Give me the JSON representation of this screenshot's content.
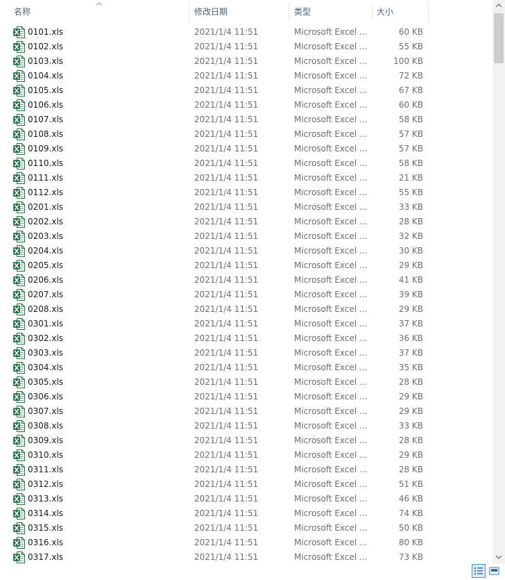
{
  "header": {
    "name_label": "名称",
    "date_label": "修改日期",
    "type_label": "类型",
    "size_label": "大小"
  },
  "accent_color": "#217346",
  "files": [
    {
      "name": "0101.xls",
      "date": "2021/1/4 11:51",
      "type": "Microsoft Excel ...",
      "size": "60 KB"
    },
    {
      "name": "0102.xls",
      "date": "2021/1/4 11:51",
      "type": "Microsoft Excel ...",
      "size": "55 KB"
    },
    {
      "name": "0103.xls",
      "date": "2021/1/4 11:51",
      "type": "Microsoft Excel ...",
      "size": "100 KB"
    },
    {
      "name": "0104.xls",
      "date": "2021/1/4 11:51",
      "type": "Microsoft Excel ...",
      "size": "72 KB"
    },
    {
      "name": "0105.xls",
      "date": "2021/1/4 11:51",
      "type": "Microsoft Excel ...",
      "size": "67 KB"
    },
    {
      "name": "0106.xls",
      "date": "2021/1/4 11:51",
      "type": "Microsoft Excel ...",
      "size": "60 KB"
    },
    {
      "name": "0107.xls",
      "date": "2021/1/4 11:51",
      "type": "Microsoft Excel ...",
      "size": "58 KB"
    },
    {
      "name": "0108.xls",
      "date": "2021/1/4 11:51",
      "type": "Microsoft Excel ...",
      "size": "57 KB"
    },
    {
      "name": "0109.xls",
      "date": "2021/1/4 11:51",
      "type": "Microsoft Excel ...",
      "size": "57 KB"
    },
    {
      "name": "0110.xls",
      "date": "2021/1/4 11:51",
      "type": "Microsoft Excel ...",
      "size": "58 KB"
    },
    {
      "name": "0111.xls",
      "date": "2021/1/4 11:51",
      "type": "Microsoft Excel ...",
      "size": "21 KB"
    },
    {
      "name": "0112.xls",
      "date": "2021/1/4 11:51",
      "type": "Microsoft Excel ...",
      "size": "55 KB"
    },
    {
      "name": "0201.xls",
      "date": "2021/1/4 11:51",
      "type": "Microsoft Excel ...",
      "size": "33 KB"
    },
    {
      "name": "0202.xls",
      "date": "2021/1/4 11:51",
      "type": "Microsoft Excel ...",
      "size": "28 KB"
    },
    {
      "name": "0203.xls",
      "date": "2021/1/4 11:51",
      "type": "Microsoft Excel ...",
      "size": "32 KB"
    },
    {
      "name": "0204.xls",
      "date": "2021/1/4 11:51",
      "type": "Microsoft Excel ...",
      "size": "30 KB"
    },
    {
      "name": "0205.xls",
      "date": "2021/1/4 11:51",
      "type": "Microsoft Excel ...",
      "size": "29 KB"
    },
    {
      "name": "0206.xls",
      "date": "2021/1/4 11:51",
      "type": "Microsoft Excel ...",
      "size": "41 KB"
    },
    {
      "name": "0207.xls",
      "date": "2021/1/4 11:51",
      "type": "Microsoft Excel ...",
      "size": "39 KB"
    },
    {
      "name": "0208.xls",
      "date": "2021/1/4 11:51",
      "type": "Microsoft Excel ...",
      "size": "29 KB"
    },
    {
      "name": "0301.xls",
      "date": "2021/1/4 11:51",
      "type": "Microsoft Excel ...",
      "size": "37 KB"
    },
    {
      "name": "0302.xls",
      "date": "2021/1/4 11:51",
      "type": "Microsoft Excel ...",
      "size": "36 KB"
    },
    {
      "name": "0303.xls",
      "date": "2021/1/4 11:51",
      "type": "Microsoft Excel ...",
      "size": "37 KB"
    },
    {
      "name": "0304.xls",
      "date": "2021/1/4 11:51",
      "type": "Microsoft Excel ...",
      "size": "35 KB"
    },
    {
      "name": "0305.xls",
      "date": "2021/1/4 11:51",
      "type": "Microsoft Excel ...",
      "size": "28 KB"
    },
    {
      "name": "0306.xls",
      "date": "2021/1/4 11:51",
      "type": "Microsoft Excel ...",
      "size": "29 KB"
    },
    {
      "name": "0307.xls",
      "date": "2021/1/4 11:51",
      "type": "Microsoft Excel ...",
      "size": "29 KB"
    },
    {
      "name": "0308.xls",
      "date": "2021/1/4 11:51",
      "type": "Microsoft Excel ...",
      "size": "33 KB"
    },
    {
      "name": "0309.xls",
      "date": "2021/1/4 11:51",
      "type": "Microsoft Excel ...",
      "size": "28 KB"
    },
    {
      "name": "0310.xls",
      "date": "2021/1/4 11:51",
      "type": "Microsoft Excel ...",
      "size": "29 KB"
    },
    {
      "name": "0311.xls",
      "date": "2021/1/4 11:51",
      "type": "Microsoft Excel ...",
      "size": "28 KB"
    },
    {
      "name": "0312.xls",
      "date": "2021/1/4 11:51",
      "type": "Microsoft Excel ...",
      "size": "51 KB"
    },
    {
      "name": "0313.xls",
      "date": "2021/1/4 11:51",
      "type": "Microsoft Excel ...",
      "size": "46 KB"
    },
    {
      "name": "0314.xls",
      "date": "2021/1/4 11:51",
      "type": "Microsoft Excel ...",
      "size": "74 KB"
    },
    {
      "name": "0315.xls",
      "date": "2021/1/4 11:51",
      "type": "Microsoft Excel ...",
      "size": "50 KB"
    },
    {
      "name": "0316.xls",
      "date": "2021/1/4 11:51",
      "type": "Microsoft Excel ...",
      "size": "80 KB"
    },
    {
      "name": "0317.xls",
      "date": "2021/1/4 11:51",
      "type": "Microsoft Excel ...",
      "size": "73 KB"
    }
  ],
  "icons": {
    "file": "excel-file-icon",
    "sort": "sort-ascending-icon",
    "scroll_up": "scroll-up-arrow-icon",
    "scroll_down": "scroll-down-arrow-icon",
    "details_view": "details-view-icon",
    "large_icons_view": "large-icons-view-icon"
  }
}
